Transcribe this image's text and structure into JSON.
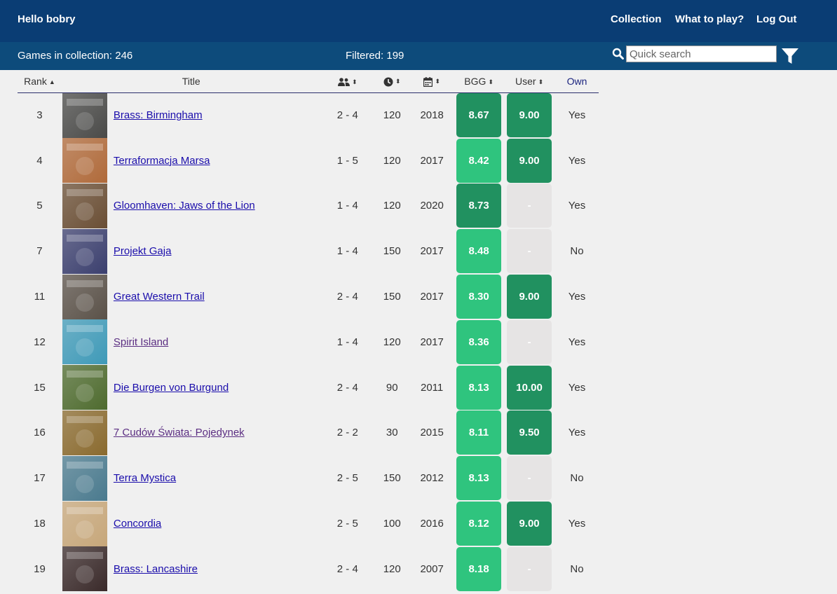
{
  "header": {
    "greeting": "Hello bobry",
    "nav": [
      "Collection",
      "What to play?",
      "Log Out"
    ]
  },
  "subbar": {
    "count": "Games in collection: 246",
    "filtered": "Filtered: 199",
    "search_placeholder": "Quick search"
  },
  "columns": {
    "rank": "Rank",
    "title": "Title",
    "bgg": "BGG",
    "user": "User",
    "own": "Own",
    "players_icon": "users-icon",
    "time_icon": "clock-icon",
    "year_icon": "calendar-icon"
  },
  "colors": {
    "topbar": "#0a3d74",
    "subbar": "#0d4b7b",
    "score_high": "#219160",
    "score_mid": "#2fc47e",
    "score_none": "#e6e4e4"
  },
  "rows": [
    {
      "rank": "3",
      "title": "Brass: Birmingham",
      "players": "2 - 4",
      "time": "120",
      "year": "2018",
      "bgg": "8.67",
      "bgg_level": "hi",
      "user": "9.00",
      "user_level": "hi",
      "own": "Yes",
      "thumb": "#4a4a48",
      "visited": false
    },
    {
      "rank": "4",
      "title": "Terraformacja Marsa",
      "players": "1 - 5",
      "time": "120",
      "year": "2017",
      "bgg": "8.42",
      "bgg_level": "mid",
      "user": "9.00",
      "user_level": "hi",
      "own": "Yes",
      "thumb": "#b06a3a",
      "visited": false
    },
    {
      "rank": "5",
      "title": "Gloomhaven: Jaws of the Lion",
      "players": "1 - 4",
      "time": "120",
      "year": "2020",
      "bgg": "8.73",
      "bgg_level": "hi",
      "user": "-",
      "user_level": "none",
      "own": "Yes",
      "thumb": "#6a4e34",
      "visited": false
    },
    {
      "rank": "7",
      "title": "Projekt Gaja",
      "players": "1 - 4",
      "time": "150",
      "year": "2017",
      "bgg": "8.48",
      "bgg_level": "mid",
      "user": "-",
      "user_level": "none",
      "own": "No",
      "thumb": "#3b3f6e",
      "visited": false
    },
    {
      "rank": "11",
      "title": "Great Western Trail",
      "players": "2 - 4",
      "time": "150",
      "year": "2017",
      "bgg": "8.30",
      "bgg_level": "mid",
      "user": "9.00",
      "user_level": "hi",
      "own": "Yes",
      "thumb": "#5a5148",
      "visited": false
    },
    {
      "rank": "12",
      "title": "Spirit Island",
      "players": "1 - 4",
      "time": "120",
      "year": "2017",
      "bgg": "8.36",
      "bgg_level": "mid",
      "user": "-",
      "user_level": "none",
      "own": "Yes",
      "thumb": "#3f9ab8",
      "visited": true
    },
    {
      "rank": "15",
      "title": "Die Burgen von Burgund",
      "players": "2 - 4",
      "time": "90",
      "year": "2011",
      "bgg": "8.13",
      "bgg_level": "mid",
      "user": "10.00",
      "user_level": "hi",
      "own": "Yes",
      "thumb": "#4e6b2e",
      "visited": false
    },
    {
      "rank": "16",
      "title": "7 Cudów Świata: Pojedynek",
      "players": "2 - 2",
      "time": "30",
      "year": "2015",
      "bgg": "8.11",
      "bgg_level": "mid",
      "user": "9.50",
      "user_level": "hi",
      "own": "Yes",
      "thumb": "#8a6a2e",
      "visited": true
    },
    {
      "rank": "17",
      "title": "Terra Mystica",
      "players": "2 - 5",
      "time": "150",
      "year": "2012",
      "bgg": "8.13",
      "bgg_level": "mid",
      "user": "-",
      "user_level": "none",
      "own": "No",
      "thumb": "#4a7a8e",
      "visited": false
    },
    {
      "rank": "18",
      "title": "Concordia",
      "players": "2 - 5",
      "time": "100",
      "year": "2016",
      "bgg": "8.12",
      "bgg_level": "mid",
      "user": "9.00",
      "user_level": "hi",
      "own": "Yes",
      "thumb": "#c7a77a",
      "visited": false
    },
    {
      "rank": "19",
      "title": "Brass: Lancashire",
      "players": "2 - 4",
      "time": "120",
      "year": "2007",
      "bgg": "8.18",
      "bgg_level": "mid",
      "user": "-",
      "user_level": "none",
      "own": "No",
      "thumb": "#3a2a2a",
      "visited": false
    }
  ]
}
